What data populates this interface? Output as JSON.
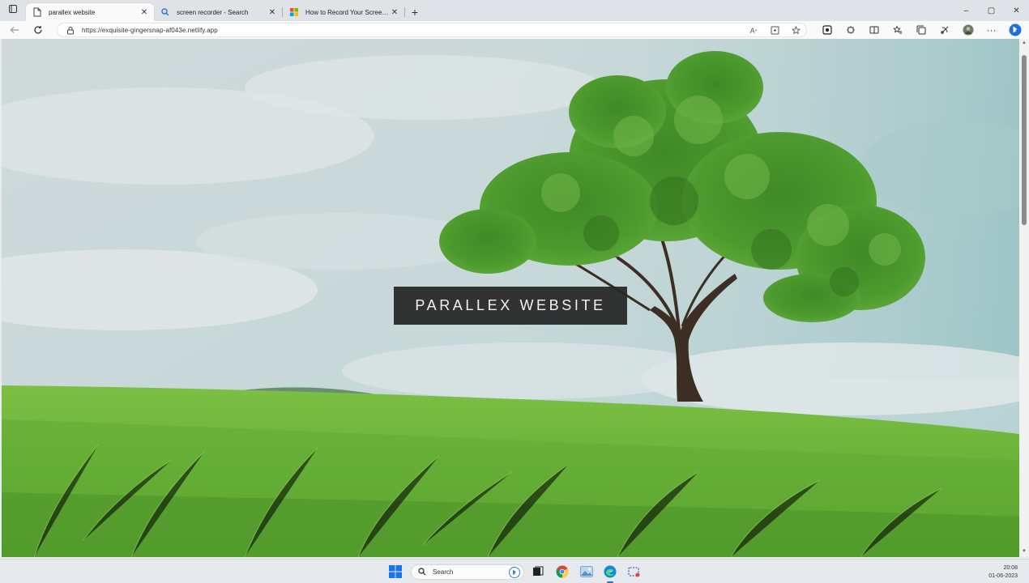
{
  "browser": {
    "tabs": [
      {
        "title": "parallex website",
        "active": true,
        "icon": "page-icon"
      },
      {
        "title": "screen recorder - Search",
        "active": false,
        "icon": "search-icon"
      },
      {
        "title": "How to Record Your Screen on W",
        "active": false,
        "icon": "microsoft-icon"
      }
    ],
    "new_tab": "+",
    "window_controls": {
      "minimize": "–",
      "maximize": "▢",
      "close": "✕"
    },
    "address_bar": {
      "url": "https://exquisite-gingersnap-af043e.netlify.app"
    }
  },
  "page": {
    "hero_title": "PARALLEX WEBSITE"
  },
  "taskbar": {
    "search_placeholder": "Search",
    "clock_time": "20:08",
    "clock_date": "01-06-2023"
  },
  "colors": {
    "accent": "#2f6fd6",
    "banner_bg": "#262626",
    "banner_text": "#f2f2f2"
  }
}
